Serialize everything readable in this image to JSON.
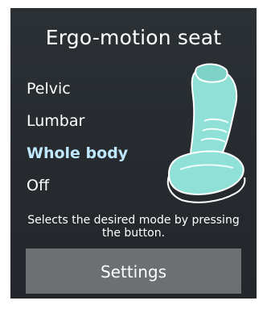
{
  "title": "Ergo-motion seat",
  "modes": [
    {
      "label": "Pelvic",
      "selected": false
    },
    {
      "label": "Lumbar",
      "selected": false
    },
    {
      "label": "Whole body",
      "selected": true
    },
    {
      "label": "Off",
      "selected": false
    }
  ],
  "hint": "Selects the desired mode by pressing the button.",
  "settings_label": "Settings",
  "colors": {
    "screen_bg": "#2b3034",
    "text": "#ffffff",
    "selected_text": "#bfe8ff",
    "seat_fill": "#8fe0d6",
    "button_bg": "#6c7073"
  },
  "icons": {
    "seat": "seat-icon"
  }
}
